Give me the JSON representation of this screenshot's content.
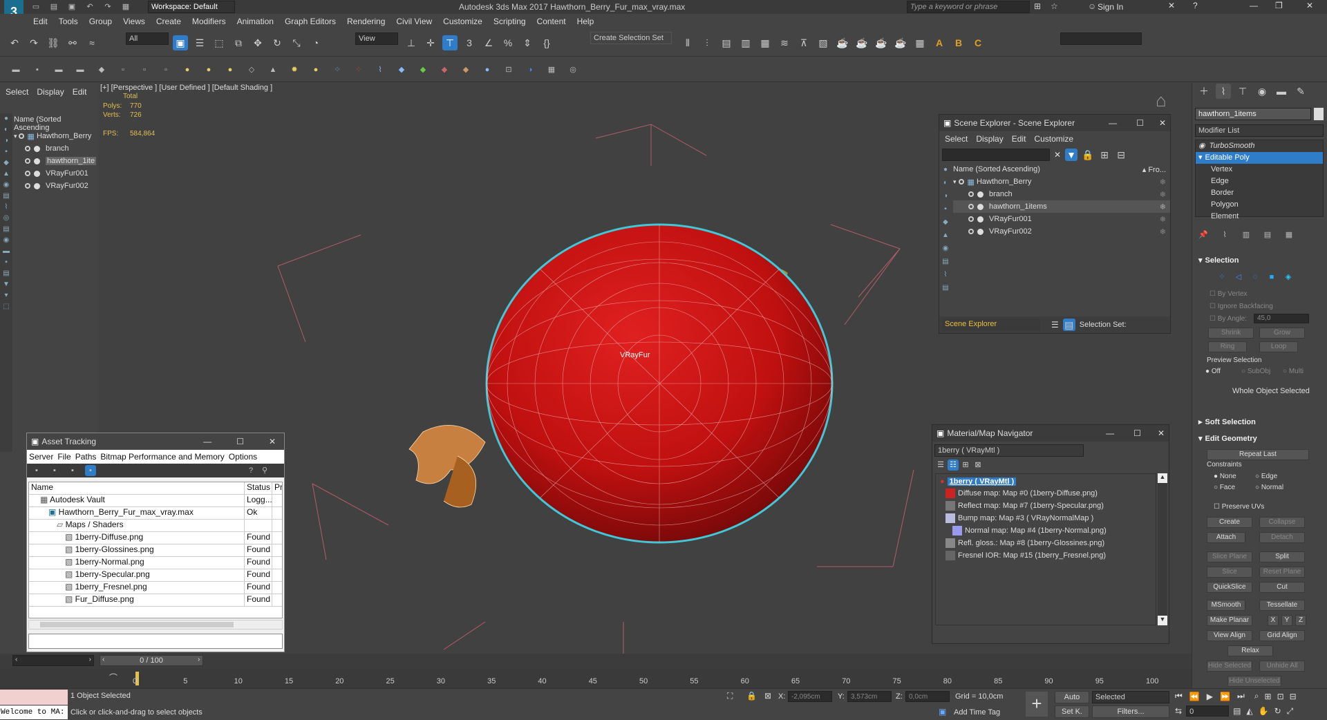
{
  "titlebar": {
    "workspace_label": "Workspace: Default",
    "title": "Autodesk 3ds Max 2017     Hawthorn_Berry_Fur_max_vray.max",
    "search_placeholder": "Type a keyword or phrase",
    "sign_in": "Sign In"
  },
  "menu": [
    "Edit",
    "Tools",
    "Group",
    "Views",
    "Create",
    "Modifiers",
    "Animation",
    "Graph Editors",
    "Rendering",
    "Civil View",
    "Customize",
    "Scripting",
    "Content",
    "Help"
  ],
  "toolbar": {
    "filter_value": "All",
    "refcoord_value": "View",
    "selection_set": "Create Selection Set"
  },
  "scene_menu": [
    "Select",
    "Display",
    "Edit"
  ],
  "viewport": {
    "label": "[+] [Perspective ] [User Defined ] [Default Shading ]",
    "stats_total": "Total",
    "polys_label": "Polys:",
    "polys_value": "770",
    "verts_label": "Verts:",
    "verts_value": "726",
    "fps_label": "FPS:",
    "fps_value": "584,864",
    "object_label": "VRayFur"
  },
  "left_tree": {
    "header": "Name (Sorted Ascending",
    "root": "Hawthorn_Berry",
    "children": [
      "branch",
      "hawthorn_1ite",
      "VRayFur001",
      "VRayFur002"
    ]
  },
  "scene_explorer": {
    "title": "Scene Explorer - Scene Explorer",
    "menu": [
      "Select",
      "Display",
      "Edit",
      "Customize"
    ],
    "col_name": "Name (Sorted Ascending)",
    "col_from": "▴ Fro...",
    "root": "Hawthorn_Berry",
    "children": [
      "branch",
      "hawthorn_1items",
      "VRayFur001",
      "VRayFur002"
    ],
    "footer_name": "Scene Explorer",
    "footer_set": "Selection Set:"
  },
  "material_navigator": {
    "title": "Material/Map Navigator",
    "field": "1berry  ( VRayMtl )",
    "root": "1berry  ( VRayMtl )",
    "items": [
      "Diffuse map: Map #0 (1berry-Diffuse.png)",
      "Reflect map: Map #7 (1berry-Specular.png)",
      "Bump map: Map #3  ( VRayNormalMap )",
      "Normal map: Map #4 (1berry-Normal.png)",
      "Refl. gloss.: Map #8 (1berry-Glossines.png)",
      "Fresnel IOR: Map #15 (1berry_Fresnel.png)"
    ]
  },
  "asset_tracking": {
    "title": "Asset Tracking",
    "menu": [
      "Server",
      "File",
      "Paths",
      "Bitmap Performance and Memory",
      "Options"
    ],
    "col_name": "Name",
    "col_status": "Status",
    "col_p": "Pr",
    "rows": [
      {
        "name": "Autodesk Vault",
        "status": "Logg...",
        "indent": 1
      },
      {
        "name": "Hawthorn_Berry_Fur_max_vray.max",
        "status": "Ok",
        "indent": 2
      },
      {
        "name": "Maps / Shaders",
        "status": "",
        "indent": 3
      },
      {
        "name": "1berry-Diffuse.png",
        "status": "Found",
        "indent": 4
      },
      {
        "name": "1berry-Glossines.png",
        "status": "Found",
        "indent": 4
      },
      {
        "name": "1berry-Normal.png",
        "status": "Found",
        "indent": 4
      },
      {
        "name": "1berry-Specular.png",
        "status": "Found",
        "indent": 4
      },
      {
        "name": "1berry_Fresnel.png",
        "status": "Found",
        "indent": 4
      },
      {
        "name": "Fur_Diffuse.png",
        "status": "Found",
        "indent": 4
      }
    ]
  },
  "command_panel": {
    "object_name": "hawthorn_1items",
    "modifier_list": "Modifier List",
    "stack": [
      "TurboSmooth",
      "Editable Poly",
      "Vertex",
      "Edge",
      "Border",
      "Polygon",
      "Element"
    ],
    "selection_title": "Selection",
    "by_vertex": "By Vertex",
    "ignore_backfacing": "Ignore Backfacing",
    "by_angle": "By Angle:",
    "angle_value": "45,0",
    "shrink": "Shrink",
    "grow": "Grow",
    "ring": "Ring",
    "loop": "Loop",
    "preview_selection": "Preview Selection",
    "off": "Off",
    "subobj": "SubObj",
    "multi": "Multi",
    "whole_object": "Whole Object Selected",
    "soft_selection": "Soft Selection",
    "edit_geometry": "Edit Geometry",
    "repeat_last": "Repeat Last",
    "constraints": "Constraints",
    "none": "None",
    "edge": "Edge",
    "face": "Face",
    "normal": "Normal",
    "preserve_uvs": "Preserve UVs",
    "create": "Create",
    "collapse": "Collapse",
    "attach": "Attach",
    "detach": "Detach",
    "slice_plane": "Slice Plane",
    "split": "Split",
    "slice": "Slice",
    "reset_plane": "Reset Plane",
    "quickslice": "QuickSlice",
    "cut": "Cut",
    "msmooth": "MSmooth",
    "tessellate": "Tessellate",
    "make_planar": "Make Planar",
    "x": "X",
    "y": "Y",
    "z": "Z",
    "view_align": "View Align",
    "grid_align": "Grid Align",
    "relax": "Relax",
    "hide_selected": "Hide Selected",
    "unhide_all": "Unhide All",
    "hide_unselected": "Hide Unselected"
  },
  "timeline": {
    "frame": "0 / 100",
    "ticks": [
      "0",
      "5",
      "10",
      "15",
      "20",
      "25",
      "30",
      "35",
      "40",
      "45",
      "50",
      "55",
      "60",
      "65",
      "70",
      "75",
      "80",
      "85",
      "90",
      "95",
      "100"
    ]
  },
  "status": {
    "maxscript": "Welcome to MA:",
    "selected": "1 Object Selected",
    "prompt": "Click or click-and-drag to select objects",
    "x_label": "X:",
    "x_value": "-2,095cm",
    "y_label": "Y:",
    "y_value": "3,573cm",
    "z_label": "Z:",
    "z_value": "0,0cm",
    "grid": "Grid = 10,0cm",
    "add_time_tag": "Add Time Tag",
    "auto": "Auto",
    "set_k": "Set K.",
    "selected_dd": "Selected",
    "filters": "Filters...",
    "frame_field": "0"
  }
}
